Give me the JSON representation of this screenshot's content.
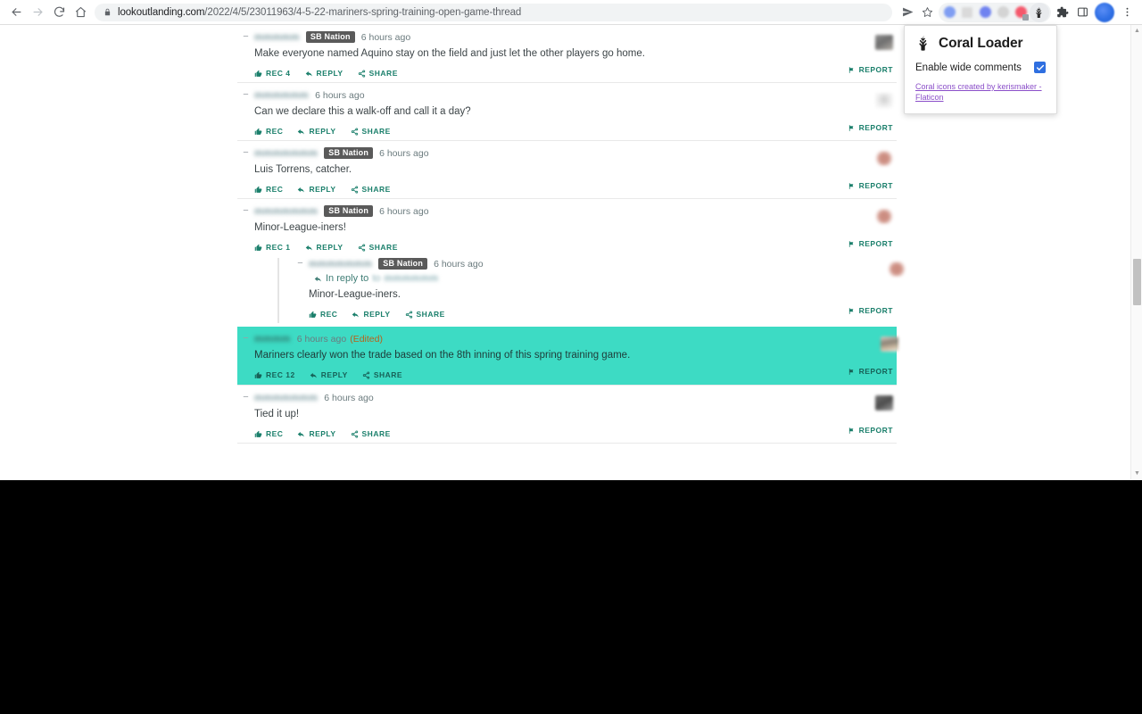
{
  "browser": {
    "url_domain": "lookoutlanding.com",
    "url_path": "/2022/4/5/23011963/4-5-22-mariners-spring-training-open-game-thread",
    "back_label": "Back",
    "forward_label": "Forward",
    "reload_label": "Reload",
    "home_label": "Home",
    "share_label": "Share",
    "bookmark_label": "Bookmark this tab",
    "extensions_label": "Extensions",
    "sidepanel_label": "Side panel",
    "profile_label": "Profile",
    "menu_label": "Customize and control Google Chrome",
    "extension_blobs": [
      {
        "name": "ext-blob-1",
        "shape": "circle",
        "color": "#7f9df2"
      },
      {
        "name": "ext-blob-2",
        "shape": "square",
        "color": "#d8d8d8"
      },
      {
        "name": "ext-blob-3",
        "shape": "circle",
        "color": "#6f82f0"
      },
      {
        "name": "ext-blob-4",
        "shape": "circle",
        "color": "#d2d2d2"
      },
      {
        "name": "ext-blob-5",
        "shape": "circle",
        "color": "#f4586b"
      }
    ]
  },
  "popup": {
    "title": "Coral Loader",
    "logo_icon": "coral-icon",
    "option_label": "Enable wide comments",
    "option_checked": true,
    "credit_text": "Coral icons created by kerismaker - Flaticon",
    "accent_color": "#2f6fe0",
    "link_color": "#8b4fc9"
  },
  "page": {
    "highlight_color": "#3ddbc4",
    "action_color": "#1a7f6b",
    "comments": [
      {
        "username": "",
        "badge": "SB Nation",
        "timestamp": "6 hours ago",
        "edited": "",
        "body": "Make everyone named Aquino stay on the field and just let the other players go home.",
        "rec_label": "REC 4",
        "reply_label": "REPLY",
        "share_label": "SHARE",
        "report_label": "REPORT",
        "avatar_style": "av-gray",
        "highlighted": false,
        "reply_to": ""
      },
      {
        "username": "",
        "badge": "",
        "timestamp": "6 hours ago",
        "edited": "",
        "body": "Can we declare this a walk-off and call it a day?",
        "rec_label": "REC",
        "reply_label": "REPLY",
        "share_label": "SHARE",
        "report_label": "REPORT",
        "avatar_style": "av-white",
        "highlighted": false,
        "reply_to": ""
      },
      {
        "username": "",
        "badge": "SB Nation",
        "timestamp": "6 hours ago",
        "edited": "",
        "body": "Luis Torrens, catcher.",
        "rec_label": "REC",
        "reply_label": "REPLY",
        "share_label": "SHARE",
        "report_label": "REPORT",
        "avatar_style": "av-coral",
        "highlighted": false,
        "reply_to": ""
      },
      {
        "username": "",
        "badge": "SB Nation",
        "timestamp": "6 hours ago",
        "edited": "",
        "body": "Minor-League-iners!",
        "rec_label": "REC 1",
        "reply_label": "REPLY",
        "share_label": "SHARE",
        "report_label": "REPORT",
        "avatar_style": "av-coral",
        "highlighted": false,
        "reply_to": ""
      },
      {
        "username": "",
        "badge": "SB Nation",
        "timestamp": "6 hours ago",
        "edited": "",
        "body": "Minor-League-iners.",
        "rec_label": "REC",
        "reply_label": "REPLY",
        "share_label": "SHARE",
        "report_label": "REPORT",
        "avatar_style": "av-coral",
        "highlighted": false,
        "reply_to": "In reply to",
        "nested": true
      },
      {
        "username": "",
        "badge": "",
        "timestamp": "6 hours ago",
        "edited": "(Edited)",
        "body": "Mariners clearly won the trade based on the 8th inning of this spring training game.",
        "rec_label": "REC 12",
        "reply_label": "REPLY",
        "share_label": "SHARE",
        "report_label": "REPORT",
        "avatar_style": "av-photo",
        "highlighted": true,
        "reply_to": ""
      },
      {
        "username": "",
        "badge": "",
        "timestamp": "6 hours ago",
        "edited": "",
        "body": "Tied it up!",
        "rec_label": "REC",
        "reply_label": "REPLY",
        "share_label": "SHARE",
        "report_label": "REPORT",
        "avatar_style": "av-dark",
        "highlighted": false,
        "reply_to": ""
      }
    ]
  }
}
